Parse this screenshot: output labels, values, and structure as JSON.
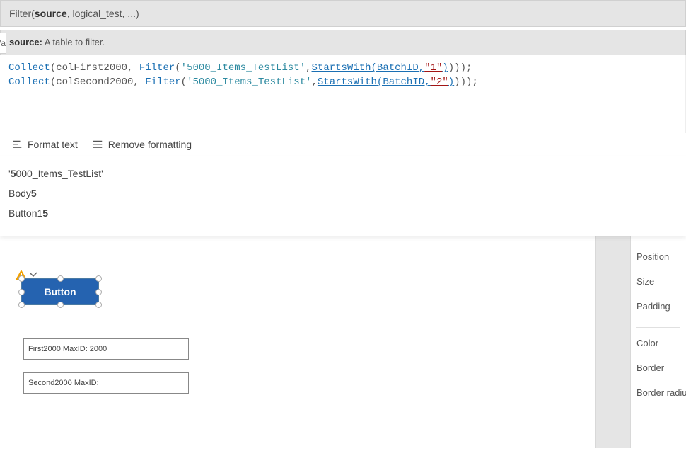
{
  "header": {
    "signature_pre": "Filter(",
    "signature_bold": "source",
    "signature_post": ", logical_test, ...)"
  },
  "tooltip": {
    "label": "source:",
    "text": " A table to filter."
  },
  "left_sliver": "/a",
  "code": {
    "lines": [
      {
        "collect": "Collect",
        "args": "(colFirst2000, ",
        "filter": "Filter",
        "tlist": "'5000_Items_TestList'",
        "comma": ",",
        "sw": "StartsWith",
        "swopen": "(BatchID,",
        "str": "\"1\"",
        "close": ")));"
      },
      {
        "collect": "Collect",
        "args": "(colSecond2000, ",
        "filter": "Filter",
        "tlist": "'5000_Items_TestList'",
        "comma": ",",
        "sw": "StartsWith",
        "swopen": "(BatchID,",
        "str": "\"2\"",
        "close": ")));"
      }
    ]
  },
  "formatbar": {
    "format": "Format text",
    "remove": "Remove formatting"
  },
  "suggestions": [
    {
      "pre": "'",
      "b": "5",
      "post": "000_Items_TestList'"
    },
    {
      "pre": "Body",
      "b": "5",
      "post": ""
    },
    {
      "pre": "Button1",
      "b": "5",
      "post": ""
    }
  ],
  "canvas": {
    "button_label": "Button",
    "text1": "First2000 MaxID: 2000",
    "text2": "Second2000 MaxID:"
  },
  "props": {
    "position": "Position",
    "size": "Size",
    "padding": "Padding",
    "color": "Color",
    "border": "Border",
    "border_radius": "Border radiu"
  }
}
